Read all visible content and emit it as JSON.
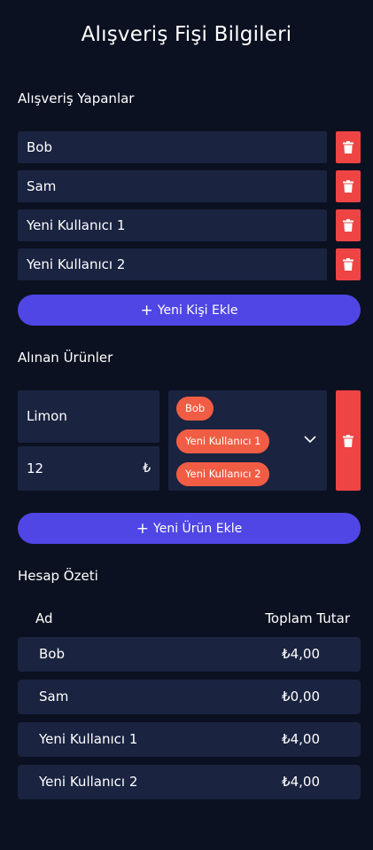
{
  "page": {
    "title": "Alışveriş Fişi Bilgileri"
  },
  "shoppers": {
    "label": "Alışveriş Yapanlar",
    "items": [
      {
        "name": "Bob"
      },
      {
        "name": "Sam"
      },
      {
        "name": "Yeni Kullanıcı 1"
      },
      {
        "name": "Yeni Kullanıcı 2"
      }
    ],
    "add_label": "Yeni Kişi Ekle"
  },
  "products": {
    "label": "Alınan Ürünler",
    "items": [
      {
        "name": "Limon",
        "price": "12",
        "currency": "₺",
        "assignees": [
          "Bob",
          "Yeni Kullanıcı 1",
          "Yeni Kullanıcı 2"
        ]
      }
    ],
    "add_label": "Yeni Ürün Ekle"
  },
  "summary": {
    "label": "Hesap Özeti",
    "col_name": "Ad",
    "col_total": "Toplam Tutar",
    "rows": [
      {
        "name": "Bob",
        "total": "₺4,00"
      },
      {
        "name": "Sam",
        "total": "₺0,00"
      },
      {
        "name": "Yeni Kullanıcı 1",
        "total": "₺4,00"
      },
      {
        "name": "Yeni Kullanıcı 2",
        "total": "₺4,00"
      }
    ]
  },
  "icons": {
    "delete": "trash-icon",
    "add": "plus-icon",
    "expand": "chevron-down-icon"
  },
  "colors": {
    "background": "#0b1120",
    "field": "#1a2340",
    "accent": "#4f46e5",
    "danger": "#ef4444",
    "chip": "#f15d44"
  }
}
